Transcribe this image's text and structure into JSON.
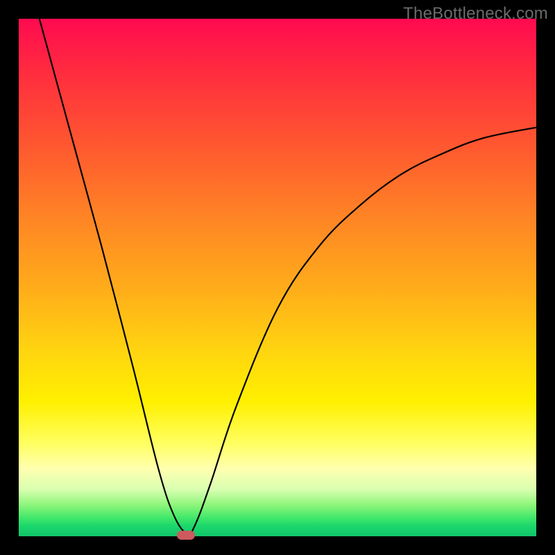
{
  "watermark": "TheBottleneck.com",
  "colors": {
    "frame_bg": "#000000",
    "curve_stroke": "#000000",
    "marker_fill": "#cc5a5e"
  },
  "chart_data": {
    "type": "line",
    "title": "",
    "xlabel": "",
    "ylabel": "",
    "xlim": [
      0,
      100
    ],
    "ylim": [
      0,
      100
    ],
    "grid": false,
    "legend": false,
    "series": [
      {
        "name": "bottleneck-curve",
        "x": [
          4,
          10,
          16,
          22,
          27,
          30,
          32.5,
          34,
          37,
          42,
          50,
          58,
          66,
          74,
          82,
          90,
          100
        ],
        "y": [
          100,
          78,
          56,
          33,
          13,
          4,
          0.5,
          2,
          10,
          25,
          44,
          56,
          64,
          70,
          74,
          77,
          79
        ]
      }
    ],
    "marker": {
      "x": 32.3,
      "y": 0.3
    }
  }
}
